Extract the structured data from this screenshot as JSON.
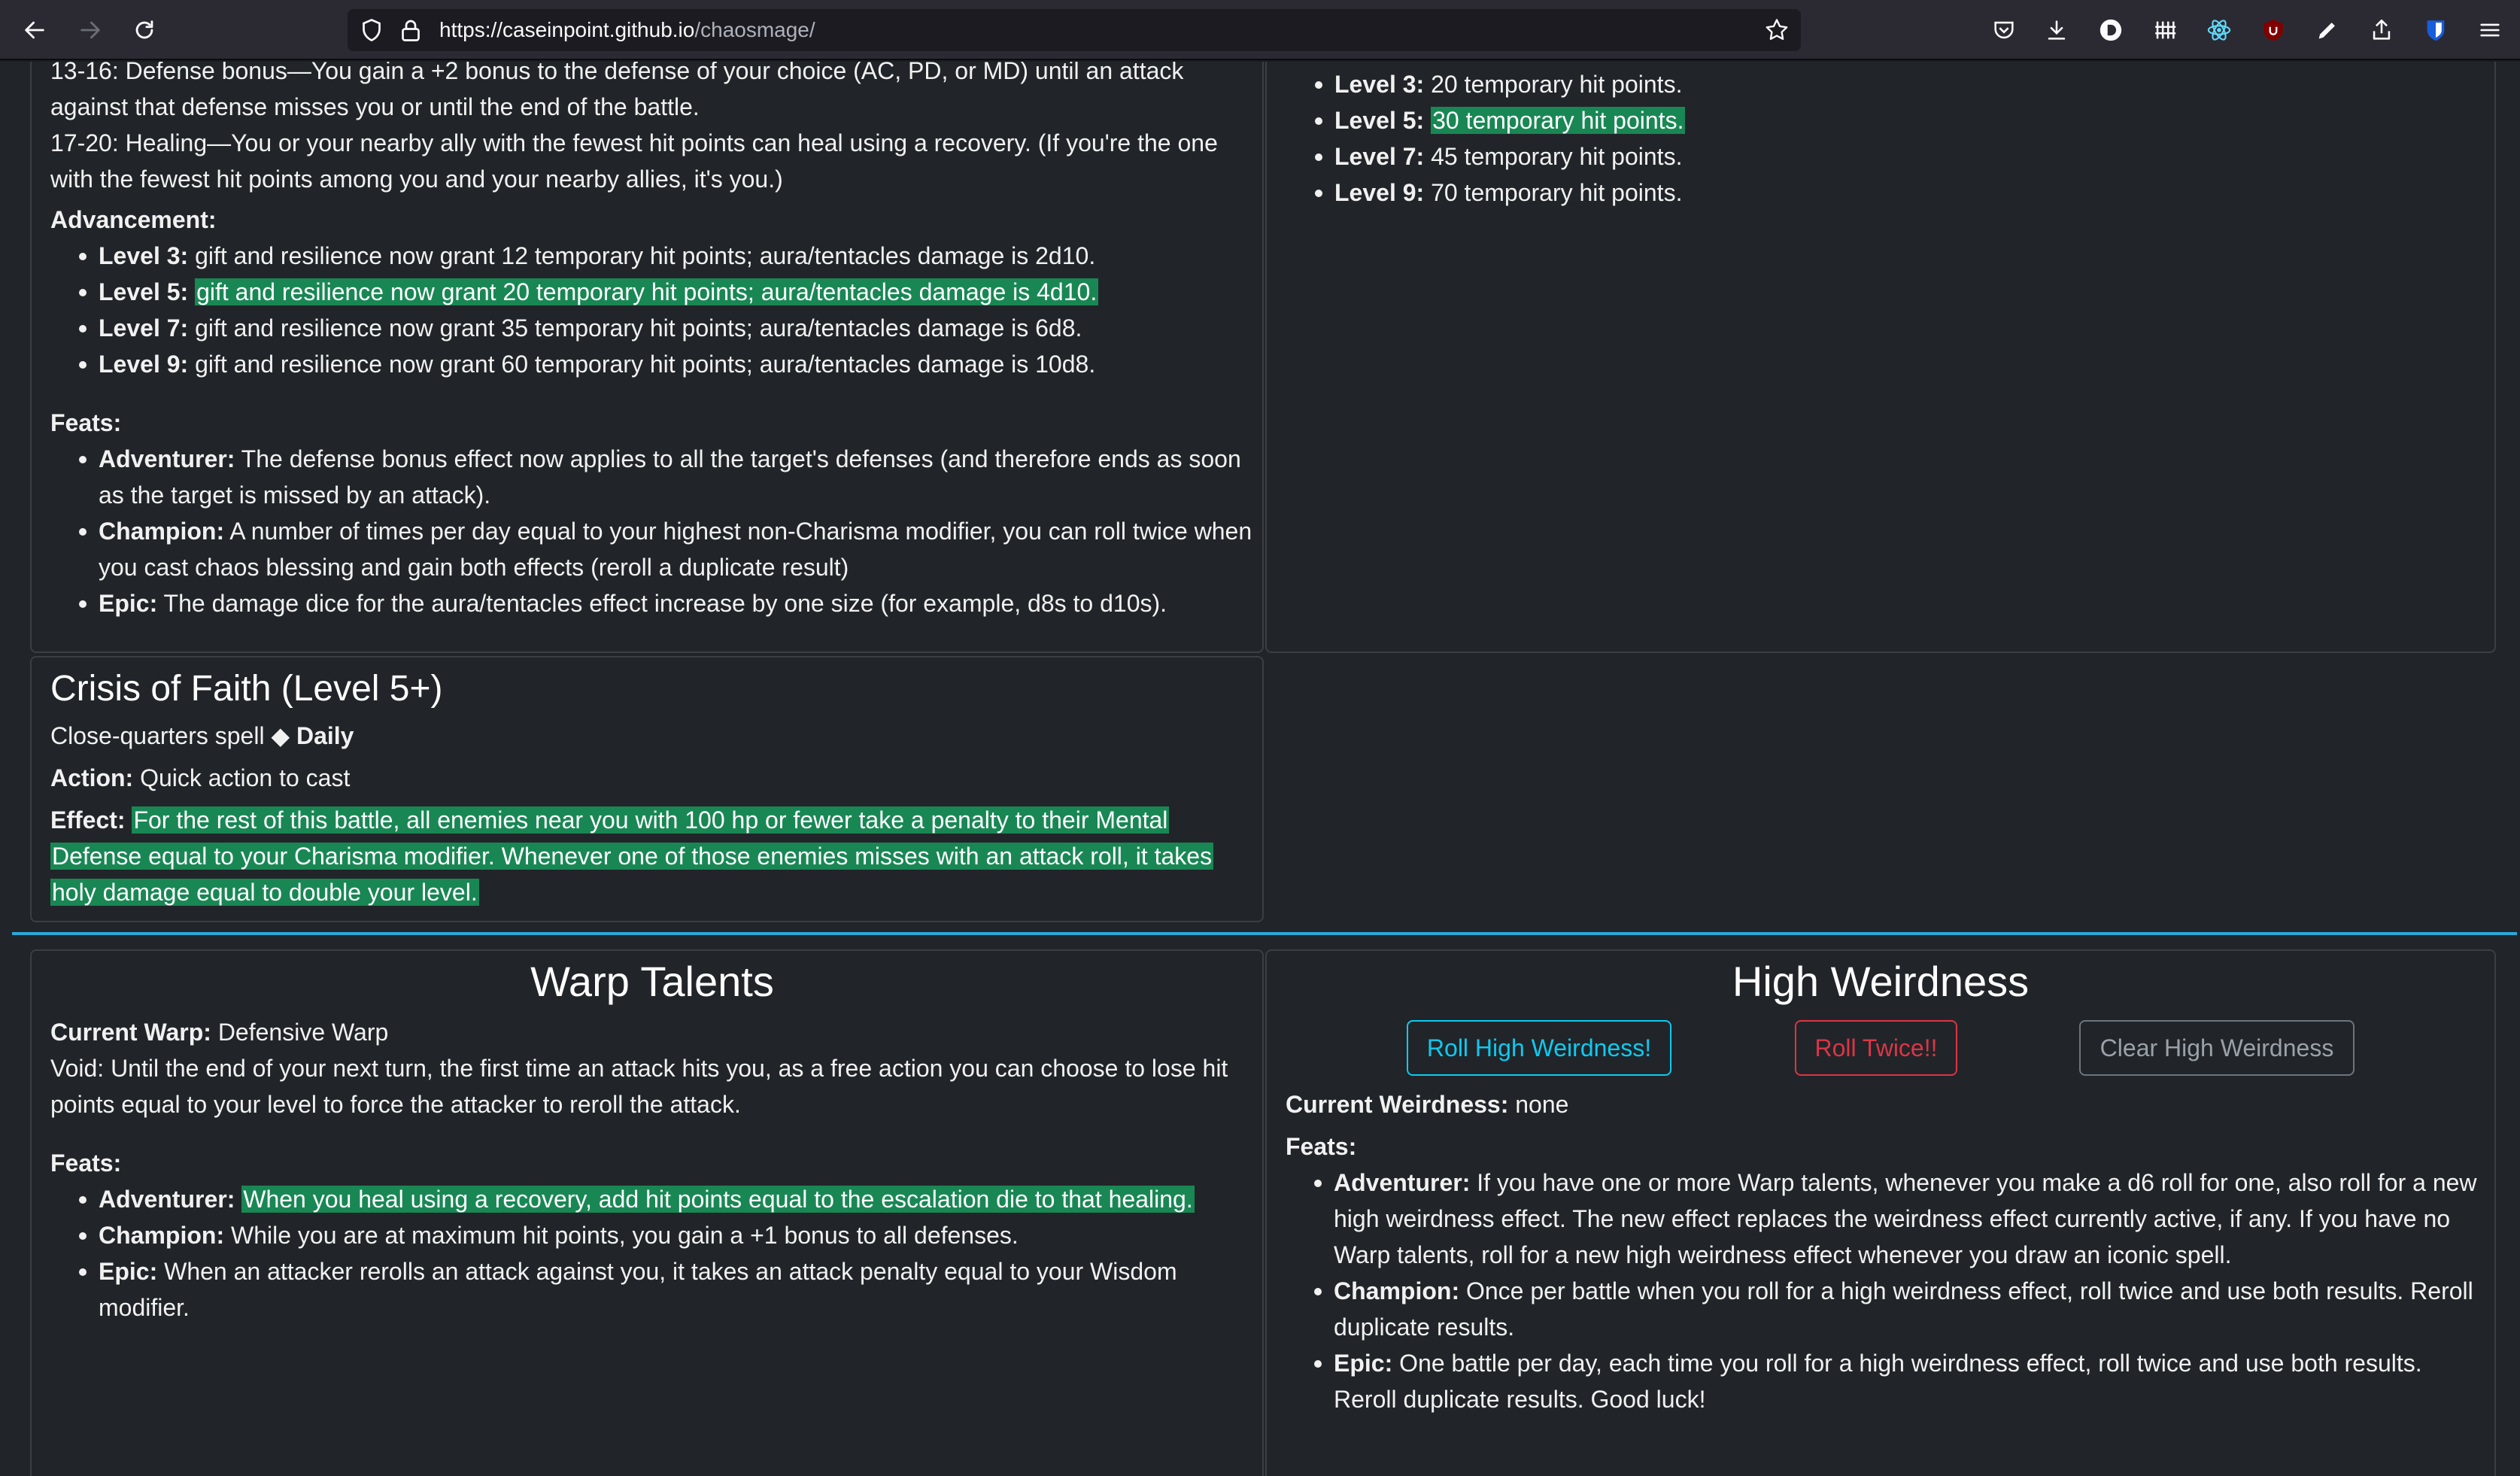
{
  "browser": {
    "url_host": "https://caseinpoint.github.io",
    "url_path": "/chaosmage/"
  },
  "left_top": {
    "defense_line": "13-16: Defense bonus—You gain a +2 bonus to the defense of your choice (AC, PD, or MD) until an attack against that defense misses you or until the end of the battle.",
    "healing_line": "17-20: Healing—You or your nearby ally with the fewest hit points can heal using a recovery. (If you're the one with the fewest hit points among you and your nearby allies, it's you.)",
    "advancement_label": "Advancement:",
    "advancement": [
      {
        "level": "Level 3:",
        "text": "gift and resilience now grant 12 temporary hit points; aura/tentacles damage is 2d10."
      },
      {
        "level": "Level 5:",
        "text": "gift and resilience now grant 20 temporary hit points; aura/tentacles damage is 4d10."
      },
      {
        "level": "Level 7:",
        "text": "gift and resilience now grant 35 temporary hit points; aura/tentacles damage is 6d8."
      },
      {
        "level": "Level 9:",
        "text": "gift and resilience now grant 60 temporary hit points; aura/tentacles damage is 10d8."
      }
    ],
    "feats_label": "Feats:",
    "feats": [
      {
        "tier": "Adventurer:",
        "text": "The defense bonus effect now applies to all the target's defenses (and therefore ends as soon as the target is missed by an attack)."
      },
      {
        "tier": "Champion:",
        "text": "A number of times per day equal to your highest non-Charisma modifier, you can roll twice when you cast chaos blessing and gain both effects (reroll a duplicate result)"
      },
      {
        "tier": "Epic:",
        "text": "The damage dice for the aura/tentacles effect increase by one size (for example, d8s to d10s)."
      }
    ]
  },
  "right_top": {
    "levels": [
      {
        "level": "Level 3:",
        "text": "20 temporary hit points."
      },
      {
        "level": "Level 5:",
        "text": "30 temporary hit points."
      },
      {
        "level": "Level 7:",
        "text": "45 temporary hit points."
      },
      {
        "level": "Level 9:",
        "text": "70 temporary hit points."
      }
    ]
  },
  "crisis": {
    "title": "Crisis of Faith (Level 5+)",
    "type": "Close-quarters spell",
    "separator": "◆",
    "frequency": "Daily",
    "action_label": "Action:",
    "action": "Quick action to cast",
    "effect_label": "Effect:",
    "effect": "For the rest of this battle, all enemies near you with 100 hp or fewer take a penalty to their Mental Defense equal to your Charisma modifier. Whenever one of those enemies misses with an attack roll, it takes holy damage equal to double your level."
  },
  "warp": {
    "title": "Warp Talents",
    "current_label": "Current Warp:",
    "current": "Defensive Warp",
    "void": "Void: Until the end of your next turn, the first time an attack hits you, as a free action you can choose to lose hit points equal to your level to force the attacker to reroll the attack.",
    "feats_label": "Feats:",
    "feats": [
      {
        "tier": "Adventurer:",
        "text": "When you heal using a recovery, add hit points equal to the escalation die to that healing."
      },
      {
        "tier": "Champion:",
        "text": "While you are at maximum hit points, you gain a +1 bonus to all defenses."
      },
      {
        "tier": "Epic:",
        "text": "When an attacker rerolls an attack against you, it takes an attack penalty equal to your Wisdom modifier."
      }
    ]
  },
  "weirdness": {
    "title": "High Weirdness",
    "roll_button": "Roll High Weirdness!",
    "twice_button": "Roll Twice!!",
    "clear_button": "Clear High Weirdness",
    "current_label": "Current Weirdness:",
    "current": "none",
    "feats_label": "Feats:",
    "feats": [
      {
        "tier": "Adventurer:",
        "text": "If you have one or more Warp talents, whenever you make a d6 roll for one, also roll for a new high weirdness effect. The new effect replaces the weirdness effect currently active, if any. If you have no Warp talents, roll for a new high weirdness effect whenever you draw an iconic spell."
      },
      {
        "tier": "Champion:",
        "text": "Once per battle when you roll for a high weirdness effect, roll twice and use both results. Reroll duplicate results."
      },
      {
        "tier": "Epic:",
        "text": "One battle per day, each time you roll for a high weirdness effect, roll twice and use both results. Reroll duplicate results. Good luck!"
      }
    ]
  },
  "colors": {
    "highlight": "#198754",
    "divider": "#2aa8d8",
    "page_bg": "#212529",
    "info": "#0dcaf0",
    "danger": "#dc3545"
  }
}
